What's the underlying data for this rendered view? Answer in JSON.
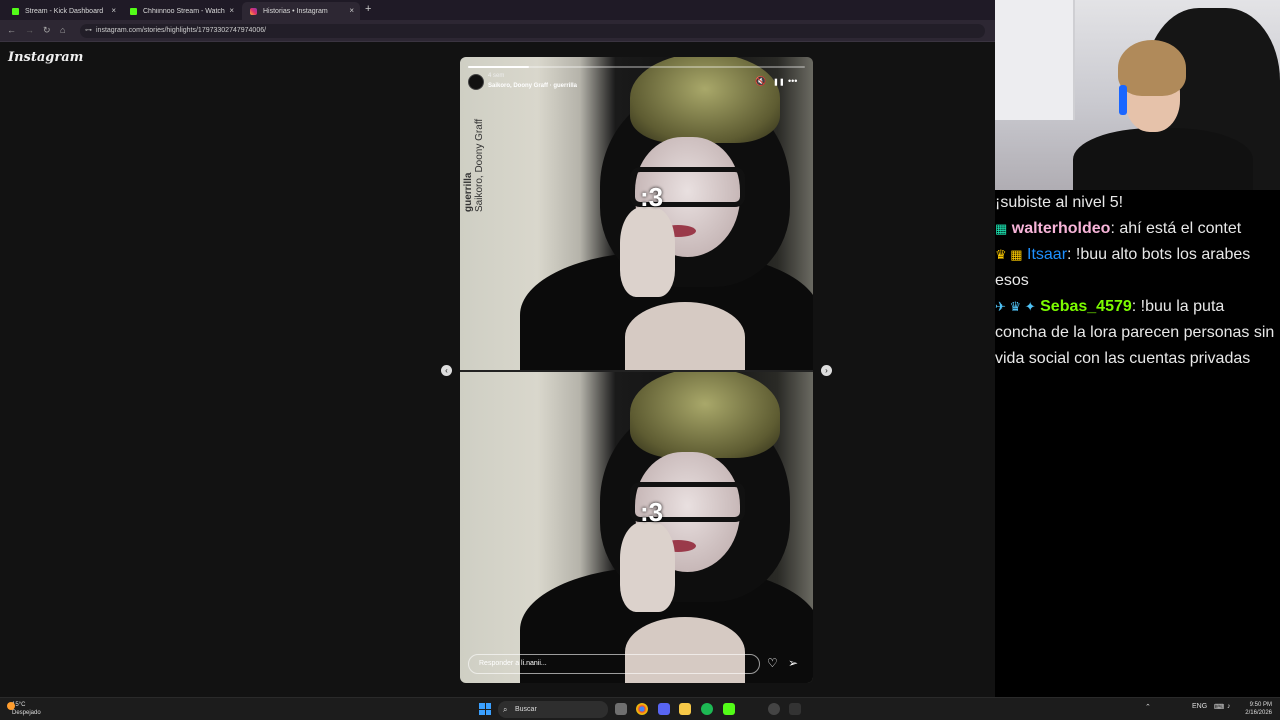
{
  "browser": {
    "tabs": [
      {
        "label": "Stream - Kick Dashboard",
        "icon": "kick-icon",
        "active": false
      },
      {
        "label": "Chhiinnoo Stream - Watch Live",
        "icon": "kick-icon",
        "active": false
      },
      {
        "label": "Historias • Instagram",
        "icon": "instagram-icon",
        "active": true
      }
    ],
    "new_tab": "+",
    "close": "×",
    "url": "instagram.com/stories/highlights/17973302747974006/"
  },
  "instagram": {
    "logo": "Instagram",
    "story": {
      "time": "4 sem",
      "audio": "Saikoro, Doony Graff · guerrilla",
      "progress": 0.18,
      "sticker": ":3",
      "vertical_title": "guerrilla",
      "vertical_subtitle": "Saikoro, Doony Graff",
      "reply_placeholder": "Responder a li.nanii...",
      "mute_icon": "🔇",
      "pause_icon": "❚❚",
      "more_icon": "•••",
      "like_icon": "♡",
      "share_icon": "➢"
    },
    "prev_arrow": "‹",
    "next_arrow": "›"
  },
  "chat": {
    "system_message": "¡subiste al nivel 5!",
    "messages": [
      {
        "badges": "▦",
        "user": "walterholdeo",
        "user_color": "#f7b4d8",
        "text": ": ahí está el contet"
      },
      {
        "badges": "♛ ▦",
        "user": "Itsaar",
        "user_color": "#1e90ff",
        "text": ": !buu alto bots los arabes esos"
      },
      {
        "badges": "✈ ♛ ✦",
        "user": "Sebas_4579",
        "user_color": "#7cfc00",
        "text": ": !buu la puta concha de la lora parecen personas sin vida social con las cuentas privadas"
      }
    ]
  },
  "taskbar": {
    "weather_temp": "15°C",
    "weather_desc": "Despejado",
    "search_placeholder": "Buscar",
    "language": "ENG",
    "time": "9:50 PM",
    "date": "2/16/2026"
  }
}
